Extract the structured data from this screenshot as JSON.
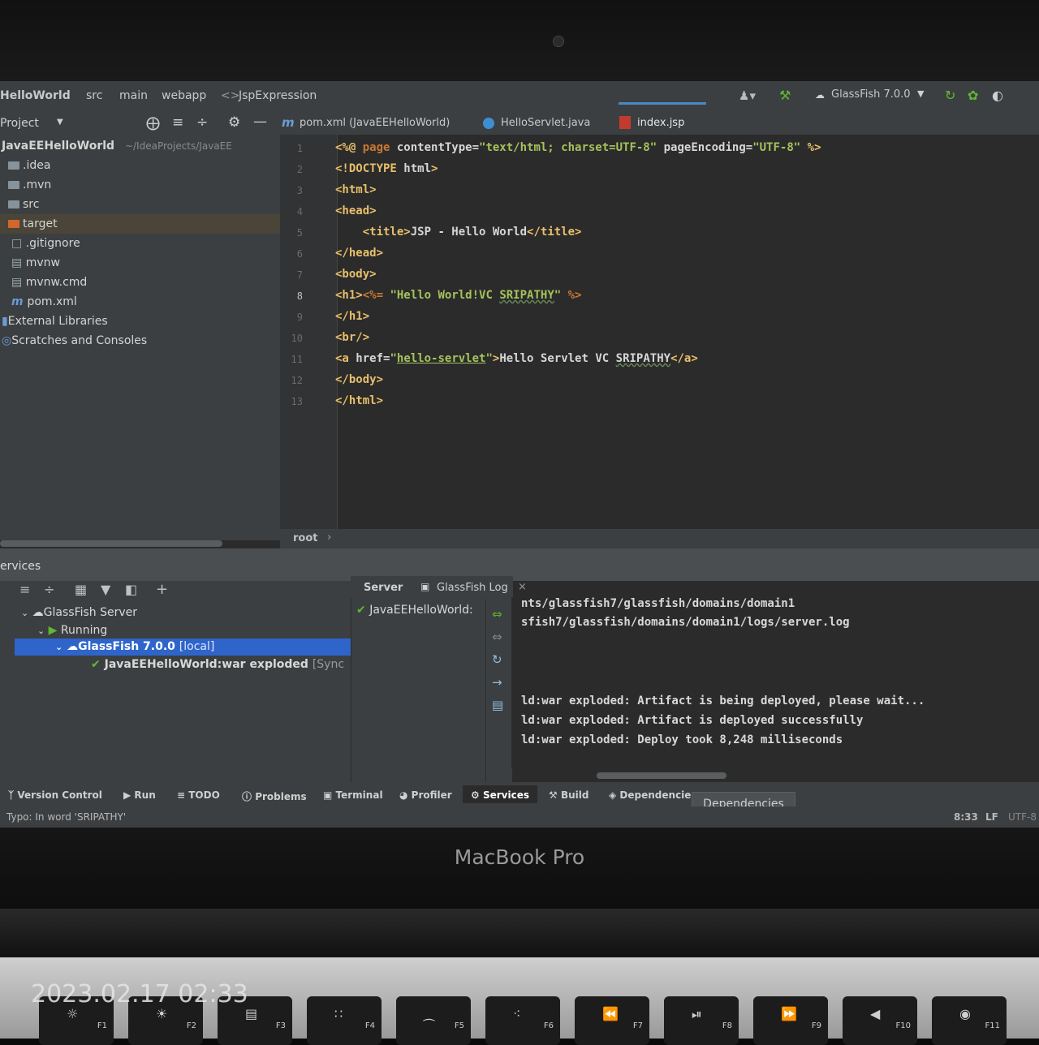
{
  "navbar": {
    "crumbs": [
      "HelloWorld",
      "src",
      "main",
      "webapp",
      "JspExpression"
    ],
    "run_config": "GlassFish 7.0.0"
  },
  "project_panel": {
    "title": "Project",
    "root_name": "JavaEEHelloWorld",
    "root_path": "~/IdeaProjects/JavaEE",
    "items": [
      ".idea",
      ".mvn",
      "src",
      "target",
      ".gitignore",
      "mvnw",
      "mvnw.cmd",
      "pom.xml",
      "External Libraries",
      "Scratches and Consoles"
    ]
  },
  "tabs": [
    "pom.xml (JavaEEHelloWorld)",
    "HelloServlet.java",
    "index.jsp"
  ],
  "editor": {
    "line_numbers": [
      "1",
      "2",
      "3",
      "4",
      "5",
      "6",
      "7",
      "8",
      "9",
      "10",
      "11",
      "12",
      "13"
    ],
    "breadcrumb": "root"
  },
  "services": {
    "title": "ervices",
    "tree": {
      "server": "GlassFish Server",
      "running": "Running",
      "instance": "GlassFish 7.0.0",
      "instance_suffix": "[local]",
      "artifact": "JavaEEHelloWorld:war exploded",
      "artifact_status": "[Sync"
    },
    "tabs": {
      "server": "Server",
      "log": "GlassFish Log"
    },
    "deployment": "JavaEEHelloWorld:",
    "console_lines": [
      "nts/glassfish7/glassfish/domains/domain1",
      "sfish7/glassfish/domains/domain1/logs/server.log",
      "ld:war exploded: Artifact is being deployed, please wait...",
      "ld:war exploded: Artifact is deployed successfully",
      "ld:war exploded: Deploy took 8,248 milliseconds"
    ]
  },
  "toolstrip": {
    "items": [
      "Version Control",
      "Run",
      "TODO",
      "Problems",
      "Terminal",
      "Profiler",
      "Services",
      "Build",
      "Dependencies"
    ],
    "tooltip": "Dependencies"
  },
  "statusbar": {
    "message": "Typo: In word 'SRIPATHY'",
    "position": "8:33",
    "line_sep": "LF",
    "encoding": "UTF-8"
  },
  "hardware": {
    "label": "MacBook Pro",
    "timestamp": "2023.02.17 02:33",
    "keys": [
      "F1",
      "F2",
      "F3",
      "F4",
      "F5",
      "F6",
      "F7",
      "F8",
      "F9",
      "F10",
      "F11"
    ]
  },
  "colors": {
    "accent": "#2f65ca",
    "tag": "#e8bf6a",
    "string": "#a5c25c",
    "keyword": "#cc7832",
    "success": "#5fb832"
  }
}
